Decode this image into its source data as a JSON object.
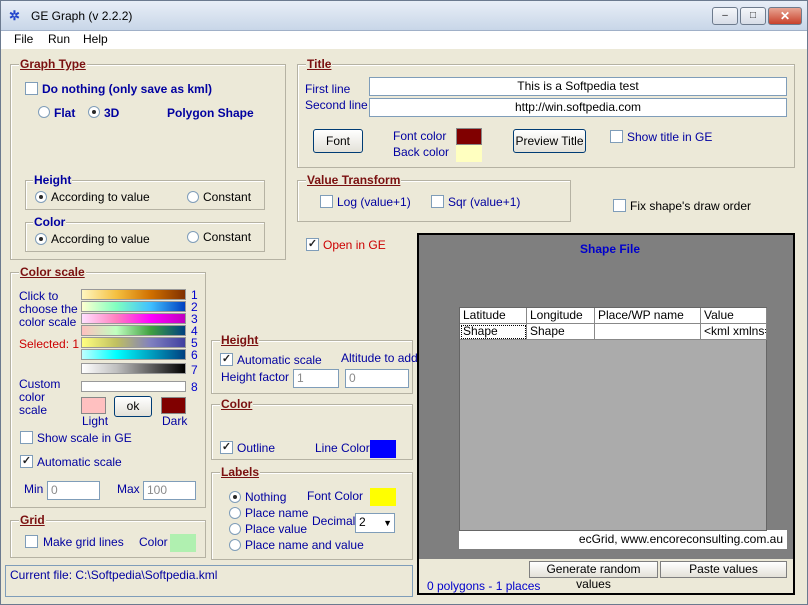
{
  "window": {
    "title": "GE Graph (v 2.2.2)",
    "app_icon": "ge-graph-icon",
    "min_label": "–",
    "max_label": "□",
    "close_label": "✕"
  },
  "menu": [
    "File",
    "Run",
    "Help"
  ],
  "graph_type": {
    "heading": "Graph Type",
    "do_nothing": "Do nothing (only save as kml)",
    "flat": "Flat",
    "three_d": "3D",
    "polygon_shape": "Polygon Shape",
    "selected": "3D"
  },
  "height_group": {
    "heading": "Height",
    "according": "According to value",
    "constant": "Constant",
    "selected": "According to value"
  },
  "color_group": {
    "heading": "Color",
    "according": "According to value",
    "constant": "Constant",
    "selected": "According to value"
  },
  "color_scale": {
    "heading": "Color scale",
    "click_line1": "Click to",
    "click_line2": "choose the",
    "click_line3": "color scale",
    "selected": "Selected: 1",
    "custom_line1": "Custom",
    "custom_line2": "color",
    "custom_line3": "scale",
    "numbers": [
      "1",
      "2",
      "3",
      "4",
      "5",
      "6",
      "7",
      "8"
    ],
    "light_label": "Light",
    "dark_label": "Dark",
    "ok_label": "ok",
    "show_scale": "Show scale in GE",
    "automatic_scale": "Automatic scale",
    "min_label": "Min",
    "min_value": "0",
    "max_label": "Max",
    "max_value": "100",
    "light_color": "#ffc0c0",
    "dark_color": "#800000"
  },
  "grid": {
    "heading": "Grid",
    "make_grid_lines": "Make grid lines",
    "color_label": "Color",
    "color": "#b0f0b0"
  },
  "title_group": {
    "heading": "Title",
    "first_line_label": "First line",
    "second_line_label": "Second line",
    "first_line": "This is a Softpedia test",
    "second_line": "http://win.softpedia.com",
    "font_button": "Font",
    "font_color_label": "Font color",
    "back_color_label": "Back color",
    "font_color": "#800000",
    "back_color": "#ffffc0",
    "preview_button": "Preview Title",
    "show_title": "Show title in GE"
  },
  "value_transform": {
    "heading": "Value Transform",
    "log": "Log (value+1)",
    "sqr": "Sqr (value+1)"
  },
  "fix_order": "Fix shape's draw order",
  "open_in_ge": "Open in GE",
  "height_panel": {
    "heading": "Height",
    "automatic_scale": "Automatic scale",
    "altitude_label": "Altitude to add",
    "height_factor_label": "Height factor",
    "height_factor": "1",
    "altitude_value": "0"
  },
  "color_panel": {
    "heading": "Color",
    "outline": "Outline",
    "line_color_label": "Line  Color",
    "line_color": "#0000ff"
  },
  "labels": {
    "heading": "Labels",
    "nothing": "Nothing",
    "place_name": "Place name",
    "place_value": "Place value",
    "place_name_value": "Place name and value",
    "font_color_label": "Font Color",
    "font_color": "#ffff00",
    "decimal_label": "Decimal",
    "decimal_value": "2",
    "selected": "Nothing"
  },
  "shape_file": {
    "heading": "Shape File",
    "columns": [
      "Latitude",
      "Longitude",
      "Place/WP name",
      "Value"
    ],
    "rows": [
      [
        "Shape",
        "Shape",
        "",
        "<kml xmlns='"
      ]
    ],
    "credit": "ecGrid,  www.encoreconsulting.com.au",
    "generate_button": "Generate random values",
    "paste_button": "Paste values",
    "status": "0 polygons - 1 places"
  },
  "status": {
    "current_file": "Current file: C:\\Softpedia\\Softpedia.kml"
  }
}
